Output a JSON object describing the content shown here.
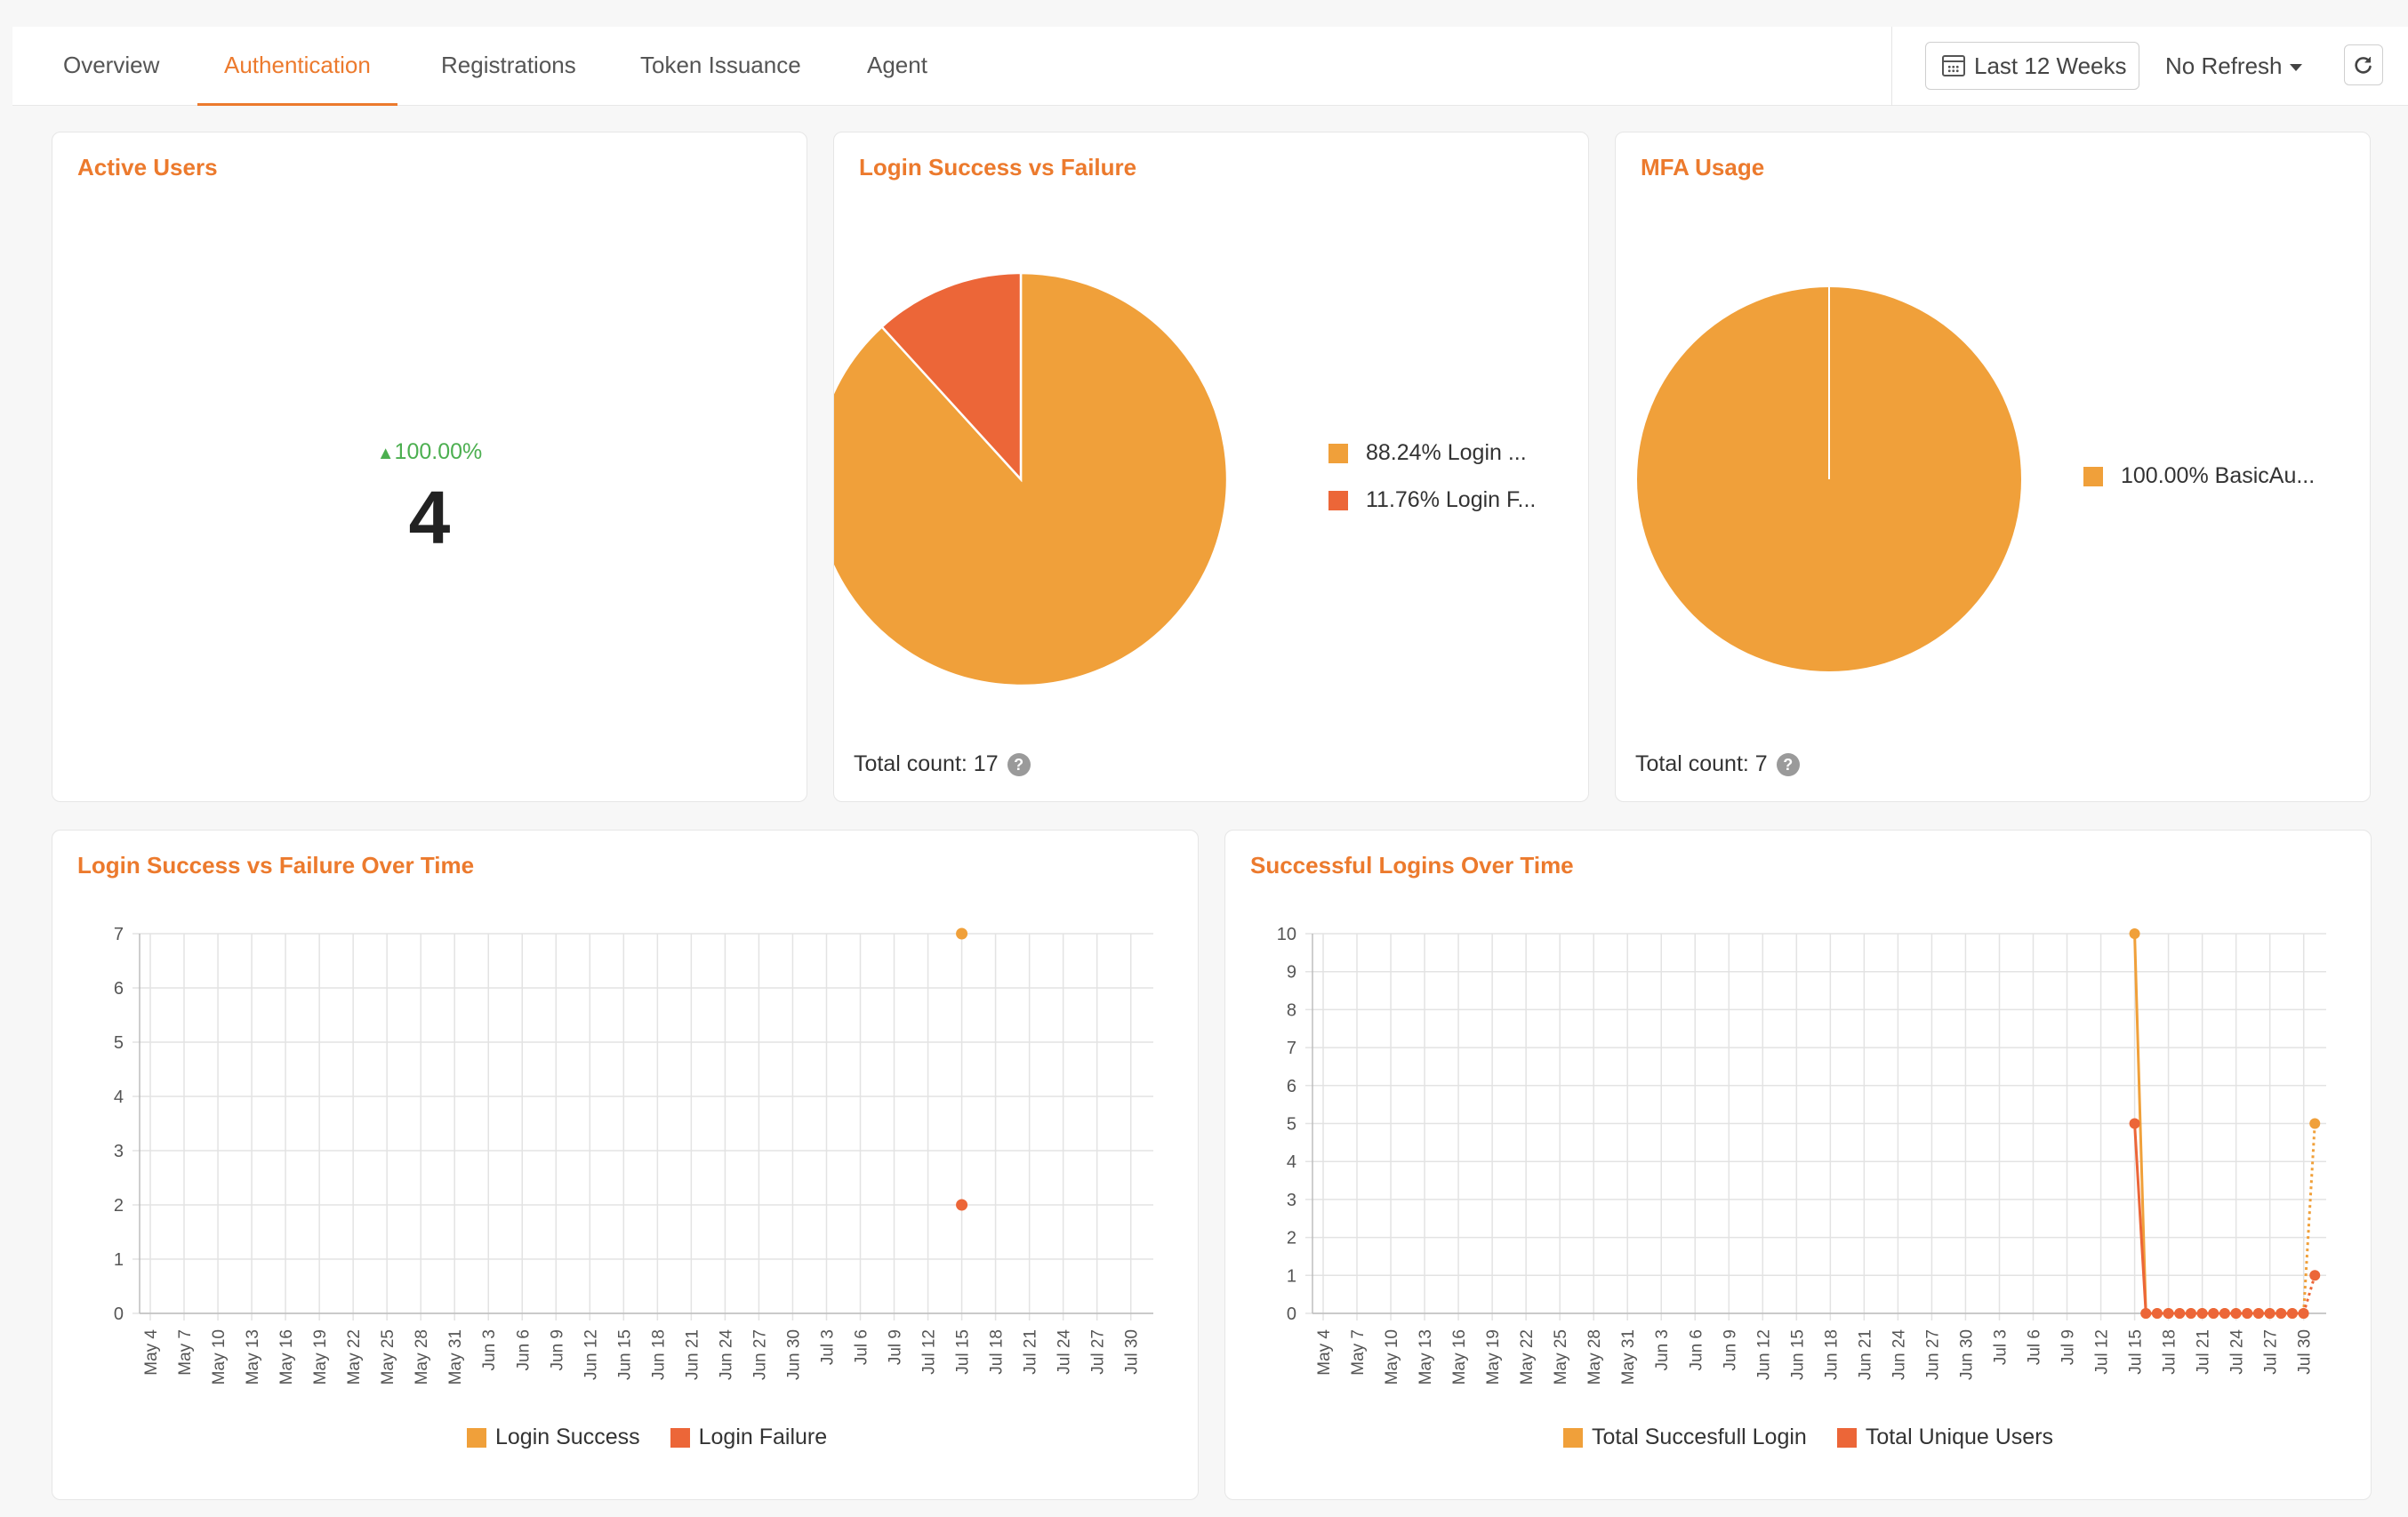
{
  "nav": {
    "tabs": [
      {
        "label": "Overview"
      },
      {
        "label": "Authentication"
      },
      {
        "label": "Registrations"
      },
      {
        "label": "Token Issuance"
      },
      {
        "label": "Agent"
      }
    ],
    "active_tab": "Authentication",
    "date_range": "Last 12 Weeks",
    "refresh": "No Refresh",
    "icons": {
      "date": "calendar-icon",
      "reload": "reload-icon",
      "dropdown": "caret-down-icon"
    }
  },
  "active_users": {
    "title": "Active Users",
    "change": "100.00%",
    "change_direction": "up",
    "value": "4"
  },
  "login_pie": {
    "title": "Login Success vs Failure",
    "legend": [
      "88.24% Login ...",
      "11.76% Login F..."
    ],
    "total": "Total count: 17",
    "colors": [
      "#f0a03a",
      "#ec6638"
    ]
  },
  "mfa_pie": {
    "title": "MFA Usage",
    "legend": [
      "100.00% BasicAu..."
    ],
    "total": "Total count: 7",
    "colors": [
      "#f0a03a"
    ]
  },
  "login_time": {
    "title": "Login Success vs Failure Over Time",
    "legend": [
      "Login Success",
      "Login Failure"
    ]
  },
  "success_time": {
    "title": "Successful Logins Over Time",
    "legend": [
      "Total Succesfull Login",
      "Total Unique Users"
    ]
  },
  "chart_data": [
    {
      "type": "pie",
      "title": "Login Success vs Failure",
      "series": [
        {
          "name": "Login Success",
          "value": 15,
          "percent": 88.24,
          "color": "#f0a03a"
        },
        {
          "name": "Login Failure",
          "value": 2,
          "percent": 11.76,
          "color": "#ec6638"
        }
      ]
    },
    {
      "type": "pie",
      "title": "MFA Usage",
      "series": [
        {
          "name": "BasicAu...",
          "value": 7,
          "percent": 100.0,
          "color": "#f0a03a"
        }
      ]
    },
    {
      "type": "scatter",
      "title": "Login Success vs Failure Over Time",
      "x": [
        "May 4",
        "May 7",
        "May 10",
        "May 13",
        "May 16",
        "May 19",
        "May 22",
        "May 25",
        "May 28",
        "May 31",
        "Jun 3",
        "Jun 6",
        "Jun 9",
        "Jun 12",
        "Jun 15",
        "Jun 18",
        "Jun 21",
        "Jun 24",
        "Jun 27",
        "Jun 30",
        "Jul 3",
        "Jul 6",
        "Jul 9",
        "Jul 12",
        "Jul 15",
        "Jul 18",
        "Jul 21",
        "Jul 24",
        "Jul 27",
        "Jul 30"
      ],
      "ylim": [
        0,
        7
      ],
      "yticks": [
        0,
        1,
        2,
        3,
        4,
        5,
        6,
        7
      ],
      "grid": true,
      "legend_position": "bottom",
      "series": [
        {
          "name": "Login Success",
          "color": "#f0a03a",
          "points": [
            {
              "x": "Jul 15",
              "y": 7
            }
          ]
        },
        {
          "name": "Login Failure",
          "color": "#ec6638",
          "points": [
            {
              "x": "Jul 15",
              "y": 2
            }
          ]
        }
      ]
    },
    {
      "type": "line",
      "title": "Successful Logins Over Time",
      "x": [
        "May 4",
        "May 7",
        "May 10",
        "May 13",
        "May 16",
        "May 19",
        "May 22",
        "May 25",
        "May 28",
        "May 31",
        "Jun 3",
        "Jun 6",
        "Jun 9",
        "Jun 12",
        "Jun 15",
        "Jun 18",
        "Jun 21",
        "Jun 24",
        "Jun 27",
        "Jun 30",
        "Jul 3",
        "Jul 6",
        "Jul 9",
        "Jul 12",
        "Jul 15",
        "Jul 18",
        "Jul 21",
        "Jul 24",
        "Jul 27",
        "Jul 30"
      ],
      "ylim": [
        0,
        10
      ],
      "yticks": [
        0,
        1,
        2,
        3,
        4,
        5,
        6,
        7,
        8,
        9,
        10
      ],
      "grid": true,
      "legend_position": "bottom",
      "series": [
        {
          "name": "Total Succesfull Login",
          "color": "#f0a03a",
          "values": [
            10,
            0,
            0,
            0,
            0,
            0,
            0,
            0,
            0,
            0,
            0,
            0,
            0,
            0,
            0,
            0,
            5
          ],
          "dotted_last_segment": true
        },
        {
          "name": "Total Unique Users",
          "color": "#ec6638",
          "values": [
            5,
            0,
            0,
            0,
            0,
            0,
            0,
            0,
            0,
            0,
            0,
            0,
            0,
            0,
            0,
            0,
            1
          ],
          "dotted_last_segment": true
        }
      ],
      "series_x_start": "Jul 15",
      "series_x_end": "Jul 31"
    }
  ]
}
